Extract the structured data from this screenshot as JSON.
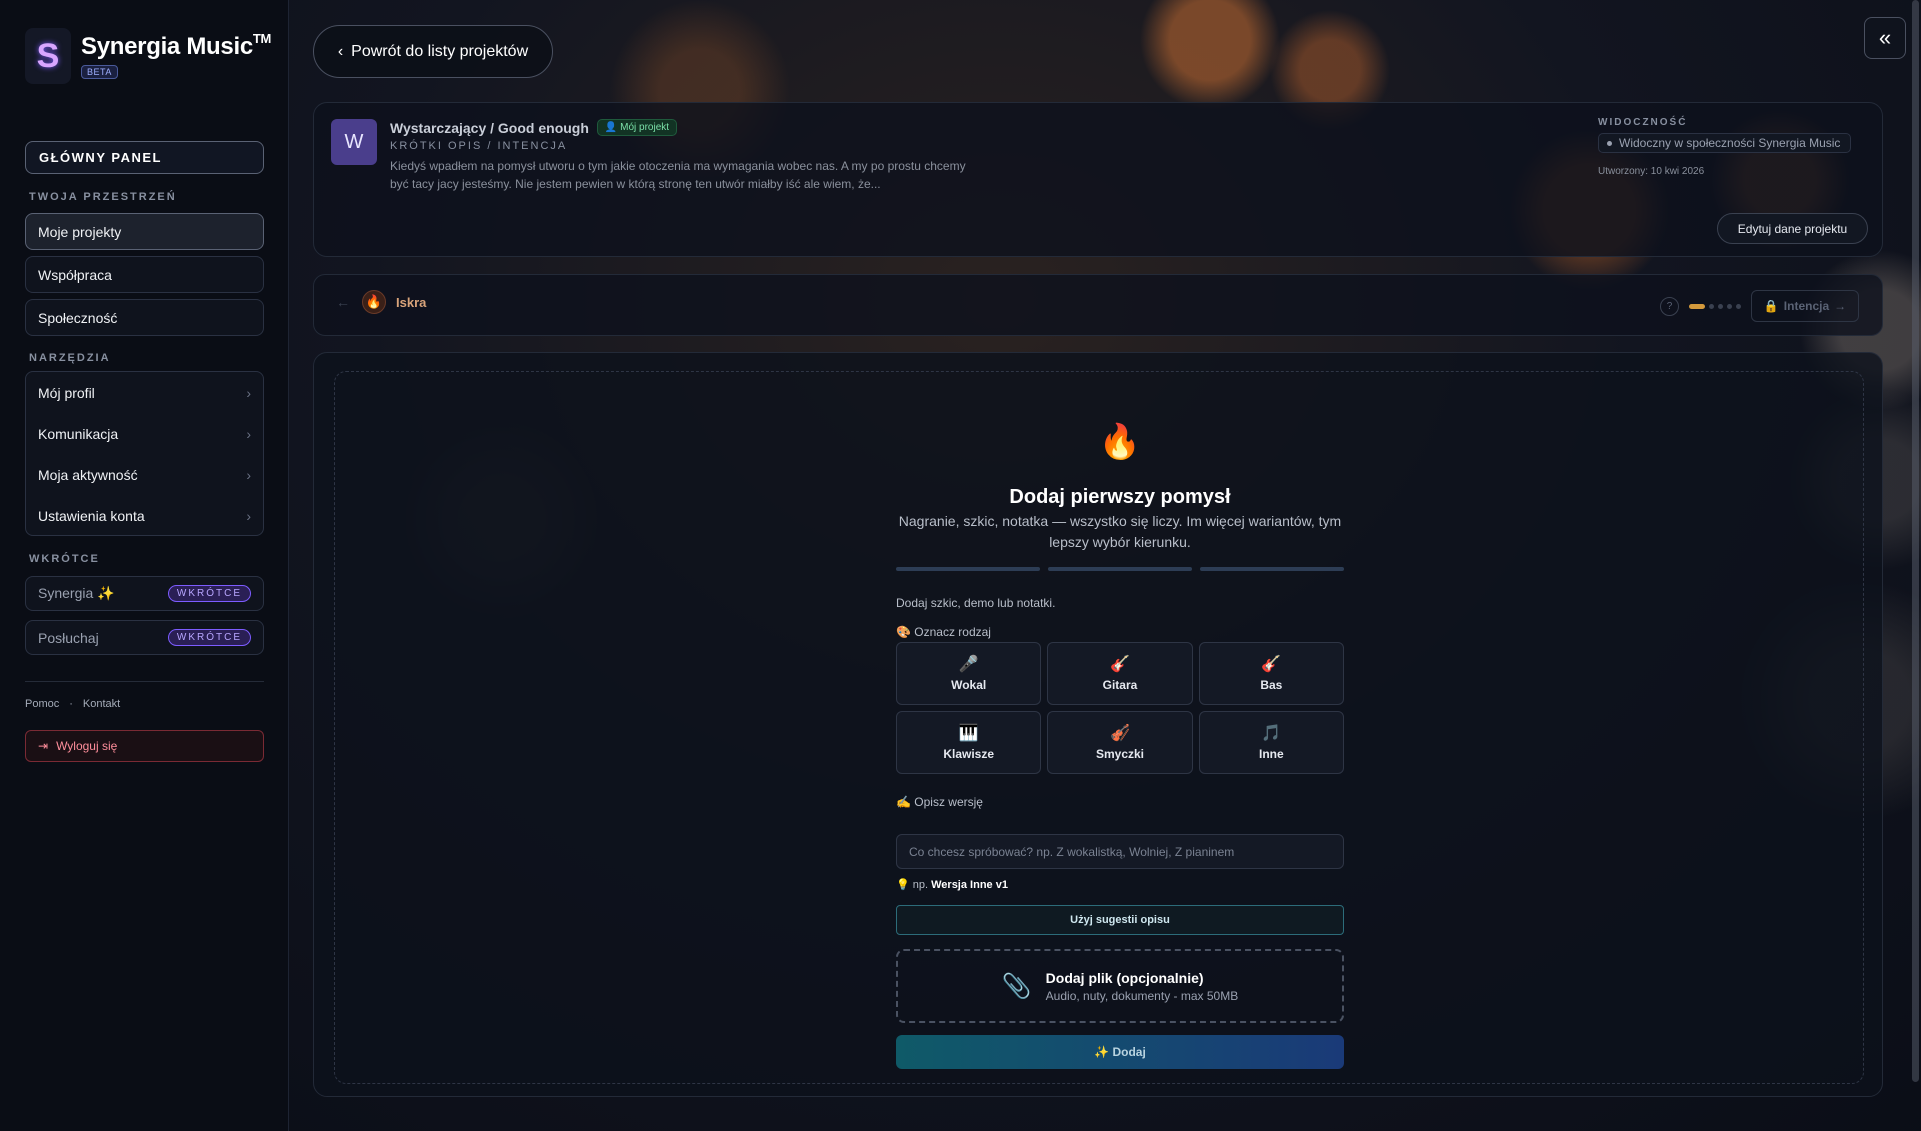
{
  "brand": {
    "logo_letter": "S",
    "name": "Synergia Music",
    "tm": "TM",
    "beta": "BETA"
  },
  "sidebar": {
    "main_panel": "GŁÓWNY PANEL",
    "workspace_label": "TWOJA PRZESTRZEŃ",
    "workspace_items": [
      {
        "label": "Moje projekty",
        "active": true
      },
      {
        "label": "Współpraca",
        "active": false
      },
      {
        "label": "Społeczność",
        "active": false
      }
    ],
    "tools_label": "NARZĘDZIA",
    "tools": [
      {
        "label": "Mój profil"
      },
      {
        "label": "Komunikacja"
      },
      {
        "label": "Moja aktywność"
      },
      {
        "label": "Ustawienia konta"
      }
    ],
    "soon_label": "WKRÓTCE",
    "soon_items": [
      {
        "label": "Synergia ✨",
        "badge": "WKRÓTCE"
      },
      {
        "label": "Posłuchaj",
        "badge": "WKRÓTCE"
      }
    ],
    "footer": {
      "help": "Pomoc",
      "sep": "·",
      "contact": "Kontakt"
    },
    "logout": "Wyloguj się"
  },
  "header": {
    "back_label": "Powrót do listy projektów"
  },
  "project": {
    "avatar_letter": "W",
    "title": "Wystarczający / Good enough",
    "badge": "Mój projekt",
    "subtitle": "KRÓTKI OPIS / INTENCJA",
    "description": "Kiedyś wpadłem na pomysł utworu o tym jakie otoczenia ma wymagania wobec nas. A my po prostu chcemy być tacy jacy jesteśmy. Nie jestem pewien w którą stronę ten utwór miałby iść ale wiem, że...",
    "visibility_label": "WIDOCZNOŚĆ",
    "visibility_value": "Widoczny w społeczności Synergia Music",
    "created": "Utworzony: 10 kwi 2026",
    "edit_label": "Edytuj dane projektu"
  },
  "stage": {
    "current_icon": "🔥",
    "current_name": "Iskra",
    "help": "?",
    "progress_step": 1,
    "progress_total": 5,
    "next_label": "Intencja"
  },
  "form": {
    "icon": "🔥",
    "headline": "Dodaj pierwszy pomysł",
    "subline": "Nagranie, szkic, notatka — wszystko się liczy. Im więcej wariantów, tym lepszy wybór kierunku.",
    "hint": "Dodaj szkic, demo lub notatki.",
    "type_label": "🎨 Oznacz rodzaj",
    "types": [
      {
        "icon": "🎤",
        "label": "Wokal"
      },
      {
        "icon": "🎸",
        "label": "Gitara"
      },
      {
        "icon": "🎸",
        "label": "Bas"
      },
      {
        "icon": "🎹",
        "label": "Klawisze"
      },
      {
        "icon": "🎻",
        "label": "Smyczki"
      },
      {
        "icon": "🎵",
        "label": "Inne"
      }
    ],
    "describe_label": "✍️ Opisz wersję",
    "describe_placeholder": "Co chcesz spróbować? np. Z wokalistką, Wolniej, Z pianinem",
    "suggest_prefix": "💡 np.",
    "suggest_value": "Wersja Inne v1",
    "use_suggestion": "Użyj sugestii opisu",
    "upload_title": "Dodaj plik (opcjonalnie)",
    "upload_sub": "Audio, nuty, dokumenty - max 50MB",
    "submit": "✨ Dodaj"
  }
}
